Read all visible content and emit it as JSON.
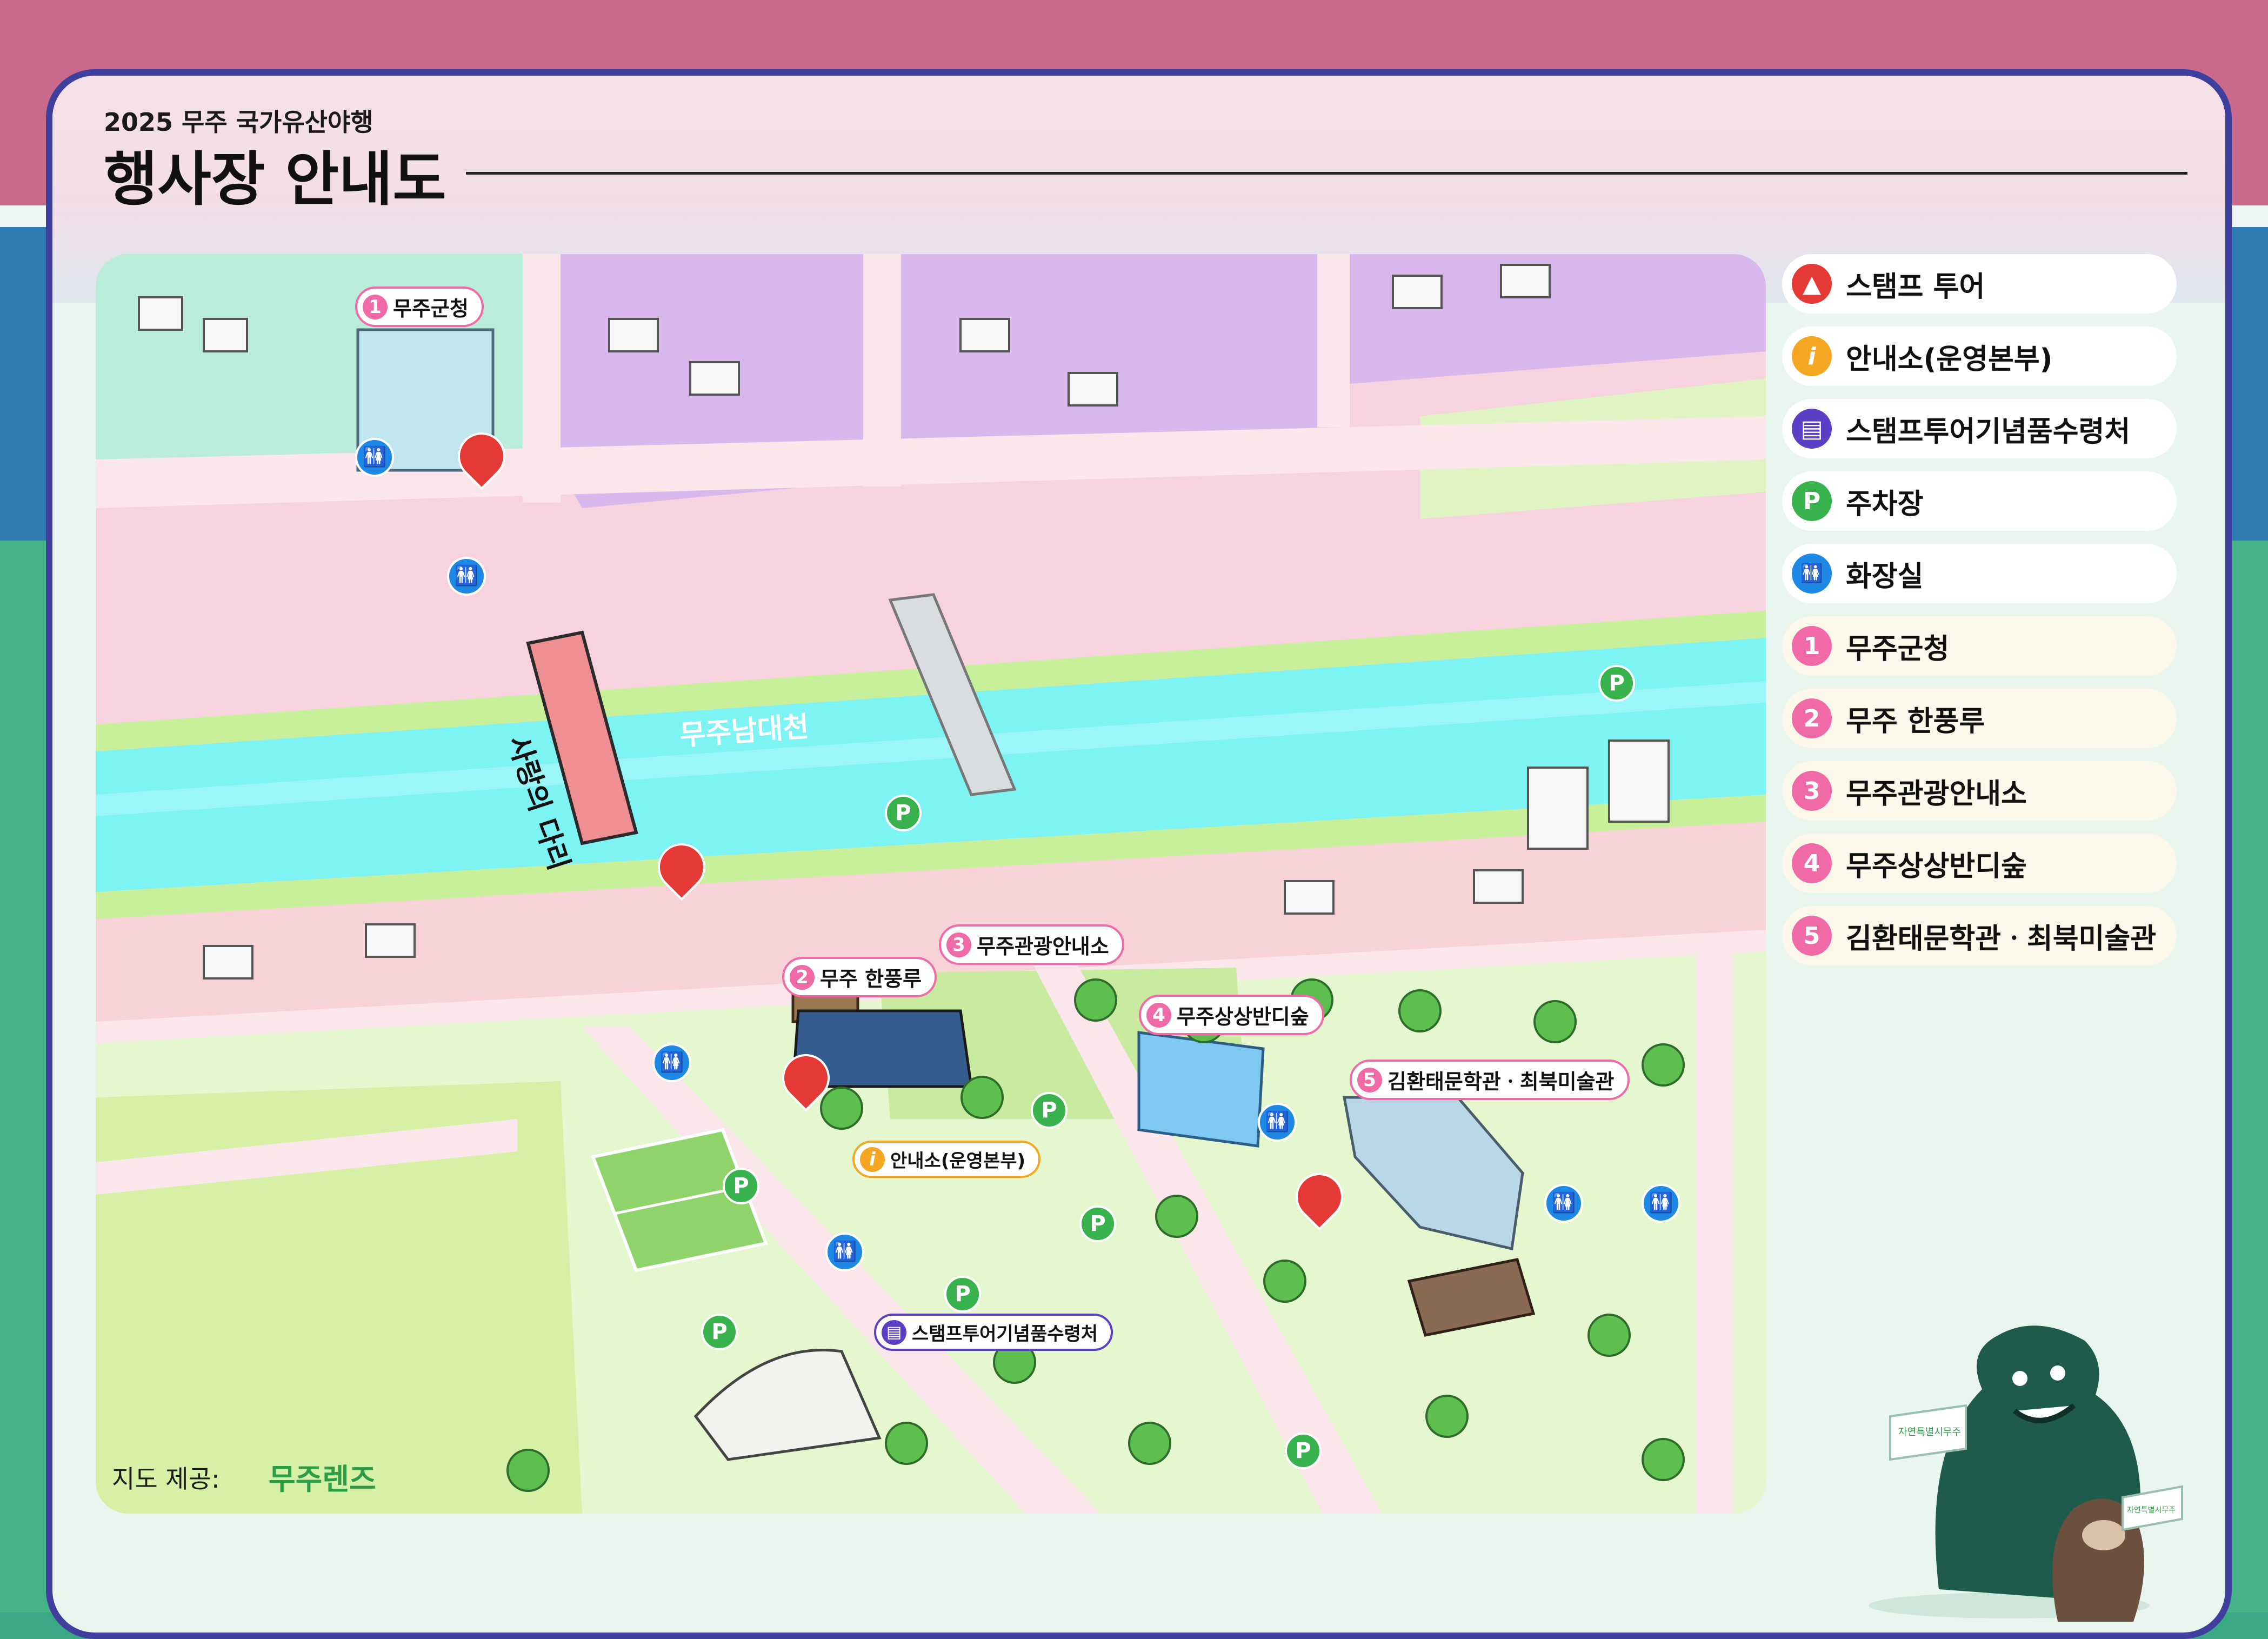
{
  "header": {
    "eyebrow": "2025 무주 국가유산야행",
    "title": "행사장 안내도"
  },
  "legend": [
    {
      "icon": "stamp-icon",
      "color": "#e53935",
      "glyph": "",
      "label": "스탬프 투어"
    },
    {
      "icon": "info-icon",
      "color": "#f5a623",
      "glyph": "i",
      "label": "안내소(운영본부)"
    },
    {
      "icon": "gift-icon",
      "color": "#5b3fc4",
      "glyph": "",
      "label": "스탬프투어기념품수령처"
    },
    {
      "icon": "parking-icon",
      "color": "#37b24d",
      "glyph": "P",
      "label": "주차장"
    },
    {
      "icon": "restroom-icon",
      "color": "#1e88e5",
      "glyph": "",
      "label": "화장실"
    },
    {
      "icon": "number-1-icon",
      "color": "#f06aa8",
      "glyph": "1",
      "label": "무주군청"
    },
    {
      "icon": "number-2-icon",
      "color": "#f06aa8",
      "glyph": "2",
      "label": "무주 한풍루"
    },
    {
      "icon": "number-3-icon",
      "color": "#f06aa8",
      "glyph": "3",
      "label": "무주관광안내소"
    },
    {
      "icon": "number-4-icon",
      "color": "#f06aa8",
      "glyph": "4",
      "label": "무주상상반디숲"
    },
    {
      "icon": "number-5-icon",
      "color": "#f06aa8",
      "glyph": "5",
      "label": "김환태문학관ㆍ최북미술관"
    }
  ],
  "map": {
    "river_name": "무주남대천",
    "bridge_name": "사랑의 다리",
    "places": [
      {
        "num": "1",
        "label": "무주군청"
      },
      {
        "num": "2",
        "label": "무주 한풍루"
      },
      {
        "num": "3",
        "label": "무주관광안내소"
      },
      {
        "num": "4",
        "label": "무주상상반디숲"
      },
      {
        "num": "5",
        "label": "김환태문학관ㆍ최북미술관"
      }
    ],
    "info_center_label": "안내소(운영본부)",
    "gift_label": "스탬프투어기념품수령처"
  },
  "footer": {
    "credit_label": "지도 제공:",
    "credit_brand": "무주렌즈",
    "mascot_flag_text": "자연특별시무주"
  }
}
